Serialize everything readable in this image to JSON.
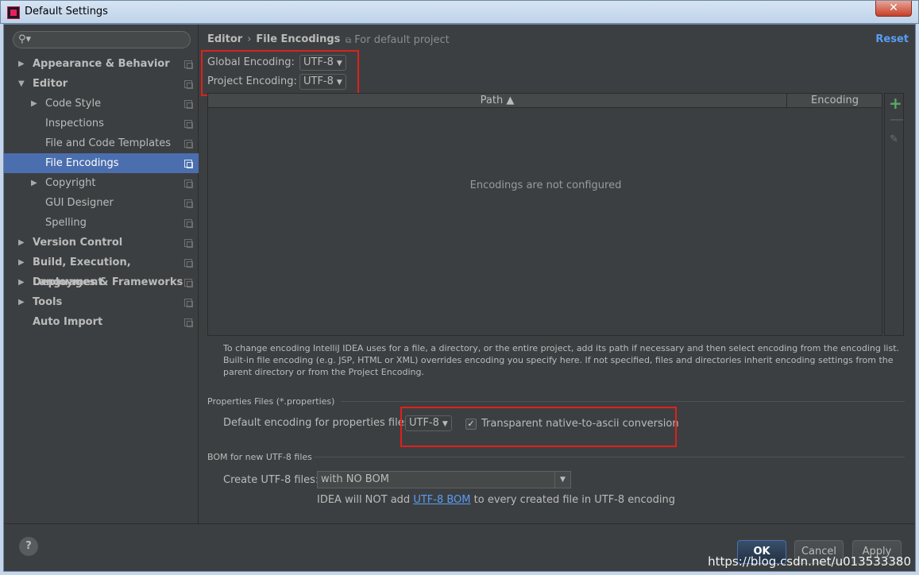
{
  "window": {
    "title": "Default Settings",
    "close_label": "✕"
  },
  "search": {
    "placeholder": ""
  },
  "sidebar": {
    "items": [
      {
        "label": "Appearance & Behavior",
        "arrow": "▶"
      },
      {
        "label": "Editor",
        "arrow": "▼"
      },
      {
        "label": "Code Style",
        "arrow": "▶"
      },
      {
        "label": "Inspections"
      },
      {
        "label": "File and Code Templates"
      },
      {
        "label": "File Encodings"
      },
      {
        "label": "Copyright",
        "arrow": "▶"
      },
      {
        "label": "GUI Designer"
      },
      {
        "label": "Spelling"
      },
      {
        "label": "Version Control",
        "arrow": "▶"
      },
      {
        "label": "Build, Execution, Deployment",
        "arrow": "▶"
      },
      {
        "label": "Languages & Frameworks",
        "arrow": "▶"
      },
      {
        "label": "Tools",
        "arrow": "▶"
      },
      {
        "label": "Auto Import"
      }
    ]
  },
  "header": {
    "crumb_editor": "Editor",
    "crumb_sep": "›",
    "crumb_page": "File Encodings",
    "for_default": "For default project",
    "reset": "Reset"
  },
  "encodings": {
    "global_label": "Global Encoding:",
    "global_value": "UTF-8",
    "project_label": "Project Encoding:",
    "project_value": "UTF-8"
  },
  "table": {
    "col_path": "Path ▲",
    "col_encoding": "Encoding",
    "empty": "Encodings are not configured"
  },
  "help_text": "To change encoding IntelliJ IDEA uses for a file, a directory, or the entire project, add its path if necessary and then select encoding from the encoding list. Built-in file encoding (e.g. JSP, HTML or XML) overrides encoding you specify here. If not specified, files and directories inherit encoding settings from the parent directory or from the Project Encoding.",
  "properties": {
    "section": "Properties Files (*.properties)",
    "default_label": "Default encoding for properties files:",
    "default_value": "UTF-8",
    "native_label": "Transparent native-to-ascii conversion",
    "native_checked": true
  },
  "bom": {
    "section": "BOM for new UTF-8 files",
    "create_label": "Create UTF-8 files:",
    "create_value": "with NO BOM",
    "note_prefix": "IDEA will NOT add ",
    "note_link": "UTF-8 BOM",
    "note_suffix": " to every created file in UTF-8 encoding"
  },
  "buttons": {
    "help": "?",
    "ok": "OK",
    "cancel": "Cancel",
    "apply": "Apply"
  },
  "watermark": "https://blog.csdn.net/u013533380",
  "colors": {
    "background": "#3c3f41",
    "selection": "#4b6eaf",
    "accent_link": "#589df6",
    "highlight_box": "#e0201c",
    "add_green": "#59a869"
  }
}
